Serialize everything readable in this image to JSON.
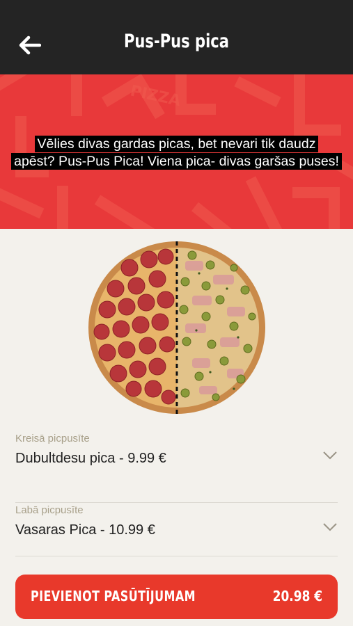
{
  "header": {
    "title": "Pus-Pus pica",
    "back_icon": "arrow-left-icon"
  },
  "banner": {
    "text_line1": "Vēlies divas gardas picas, bet nevari tik daudz",
    "text_line2": "apēst? Pus-Pus Pica! Viena pica- divas garšas puses!",
    "background_color": "#e8393a"
  },
  "left_half": {
    "label": "Kreisā picpusīte",
    "value": "Dubultdesu pica - 9.99 €"
  },
  "right_half": {
    "label": "Labā picpusīte",
    "value": "Vasaras Pica - 10.99 €"
  },
  "cta": {
    "label": "PIEVIENOT PASŪTĪJUMAM",
    "price": "20.98 €",
    "color": "#e8392b"
  }
}
